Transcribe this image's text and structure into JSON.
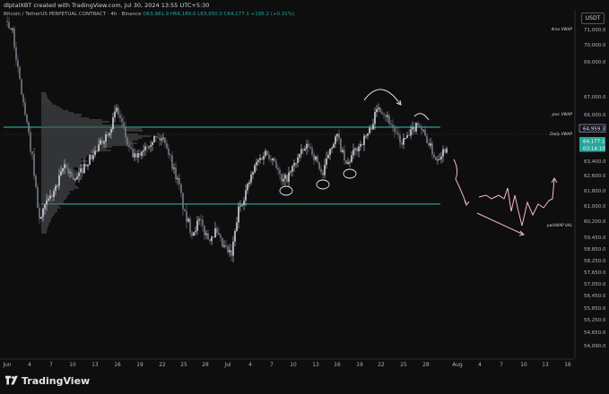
{
  "header": {
    "created_text": "dlptalXBT created with TradingView.com, Jul 30, 2024 13:55 UTC+5:30",
    "symbol_text": "Bitcoin / TetherUS PERPETUAL CONTRACT · 4h · Binance",
    "ohlc_text": "O63,981.9 H64,189.0 L63,950.0 C64,177.1 +195.2 (+0.31%)",
    "currency": "USDT"
  },
  "chart_data": {
    "type": "candlestick",
    "symbol": "Bitcoin / TetherUS PERPETUAL CONTRACT",
    "interval": "4h",
    "exchange": "Binance",
    "y_ticks": [
      "71,000.0",
      "70,000.0",
      "69,000.0",
      "67,000.0",
      "66,000.0",
      "63,400.0",
      "62,600.0",
      "61,800.0",
      "61,000.0",
      "60,200.0",
      "59,450.0",
      "58,850.0",
      "58,250.0",
      "57,650.0",
      "57,050.0",
      "56,450.0",
      "55,850.0",
      "55,250.0",
      "54,650.0",
      "54,090.0"
    ],
    "y_tick_values": [
      71000,
      70000,
      69000,
      67000,
      66000,
      63400,
      62600,
      61800,
      61000,
      60200,
      59450,
      58850,
      58250,
      57650,
      57050,
      56450,
      55850,
      55250,
      54650,
      54090
    ],
    "x_ticks": [
      "Jun",
      "4",
      "7",
      "10",
      "13",
      "16",
      "19",
      "22",
      "25",
      "28",
      "Jul",
      "4",
      "7",
      "10",
      "13",
      "16",
      "19",
      "22",
      "25",
      "28",
      "Aug",
      "4",
      "7",
      "10",
      "13",
      "16"
    ],
    "level_labels": [
      "4mo VWAP",
      "pwc VWAP",
      "Daily VWAP",
      "pwVWAP VAL"
    ],
    "level_lines": [
      65300,
      61100
    ],
    "price_tags": [
      {
        "text": "64,959.3",
        "color": "#e0e3eb",
        "bg": "#131722"
      },
      {
        "text": "64,177.1",
        "color": "#ffffff",
        "bg": "#26a69a"
      },
      {
        "text": "03:14:10",
        "color": "#ffffff",
        "bg": "#26a69a"
      }
    ],
    "ylim": [
      53800,
      72500
    ],
    "approx_range": {
      "start": "Jun 1",
      "end": "Jul 30",
      "low": 58400,
      "high": 71900,
      "last": 64177.1
    },
    "colors": {
      "up": "#d1d4dc",
      "down": "#787b86",
      "lines": "#2ec4b6",
      "projection": "#f5b8c8",
      "annot": "#e0e3eb",
      "profile": "#8a8d96"
    }
  },
  "footer": {
    "brand": "TradingView"
  }
}
